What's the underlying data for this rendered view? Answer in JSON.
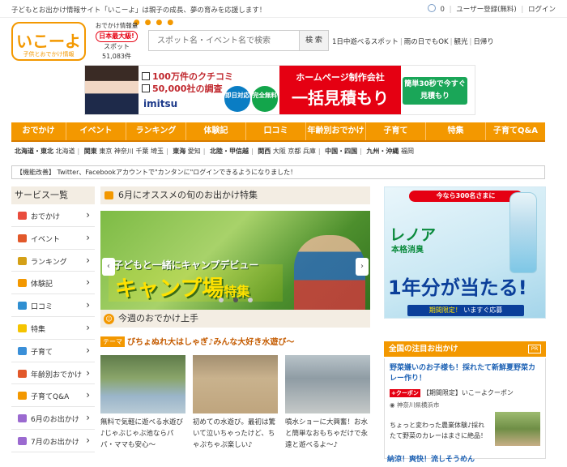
{
  "topbar": {
    "message": "子どもとお出かけ情報サイト「いこーよ」は親子の成長、夢の育みを応援します！",
    "count": "0",
    "register": "ユーザー登録(無料)",
    "login": "ログイン"
  },
  "logo": {
    "name": "いこーよ",
    "sub": "子供とおでかけ情報"
  },
  "stats": {
    "line1": "おでかけ情報量",
    "line2": "日本最大級!",
    "line3": "スポット",
    "count": "51,083件"
  },
  "search": {
    "placeholder": "スポット名・イベント名で検索",
    "button": "検 索"
  },
  "quicklinks": [
    "1日中遊べるスポット",
    "雨の日でもOK",
    "観光",
    "日帰り"
  ],
  "ad": {
    "check1": "100万件のクチコミ",
    "check2": "50,000社の調査",
    "brand": "imitsu",
    "badge1": "即日対応",
    "badge2": "完全無料",
    "headline1": "ホームページ制作会社",
    "headline2": "一括見積もり",
    "cta": "簡単30秒で今すぐ見積もり"
  },
  "nav": [
    "おでかけ",
    "イベント",
    "ランキング",
    "体験記",
    "口コミ",
    "年齢別おでかけ",
    "子育て",
    "特集",
    "子育てQ&A"
  ],
  "regions": [
    {
      "group": "北海道・東北",
      "items": [
        "北海道"
      ]
    },
    {
      "group": "関東",
      "items": [
        "東京",
        "神奈川",
        "千葉",
        "埼玉"
      ]
    },
    {
      "group": "東海",
      "items": [
        "愛知"
      ]
    },
    {
      "group": "北陸・甲信越",
      "items": []
    },
    {
      "group": "関西",
      "items": [
        "大阪",
        "京都",
        "兵庫"
      ]
    },
    {
      "group": "中国・四国",
      "items": []
    },
    {
      "group": "九州・沖縄",
      "items": [
        "福岡"
      ]
    }
  ],
  "notice": "【機能改善】 Twitter、Facebookアカウントで\"カンタンに\"ログインできるようになりました！",
  "sidebar": {
    "title": "サービス一覧",
    "items": [
      {
        "label": "おでかけ",
        "icon": "map-pin-icon",
        "color": "#e94c3d"
      },
      {
        "label": "イベント",
        "icon": "flag-icon",
        "color": "#e2582a"
      },
      {
        "label": "ランキング",
        "icon": "crown-icon",
        "color": "#d4a017"
      },
      {
        "label": "体験記",
        "icon": "notebook-icon",
        "color": "#f39800"
      },
      {
        "label": "口コミ",
        "icon": "speech-bubble-icon",
        "color": "#2f8fd1"
      },
      {
        "label": "特集",
        "icon": "folder-icon",
        "color": "#f5c400"
      },
      {
        "label": "子育て",
        "icon": "pin-icon",
        "color": "#3a8fd8"
      },
      {
        "label": "年齢別おでかけ",
        "icon": "child-icon",
        "color": "#e2582a"
      },
      {
        "label": "子育てQ&A",
        "icon": "question-icon",
        "color": "#f39800"
      },
      {
        "label": "6月のお出かけ",
        "icon": "footprint-icon",
        "color": "#9b6ad0"
      },
      {
        "label": "7月のお出かけ",
        "icon": "footprint-icon",
        "color": "#9b6ad0"
      }
    ]
  },
  "featured": {
    "title": "6月にオススメの旬のお出かけ特集",
    "hero_sub": "子どもと一緒にキャンプデビュー",
    "hero_title": "キャンプ場",
    "hero_suffix": "特集"
  },
  "weekly": {
    "title": "今週のおでかけ上手",
    "theme_tag": "テーマ",
    "theme_text": "びちょぬれ大はしゃぎ♪みんな大好き水遊び～",
    "cards": [
      {
        "caption": "無料で気軽に遊べる水遊び♪じゃぶじゃぶ池ならパパ・ママも安心～"
      },
      {
        "caption": "初めての水遊び。最初は驚いて泣いちゃったけど、ちゃぷちゃぷ楽しい♪"
      },
      {
        "caption": "噴水ショーに大興奮！お水と簡単なおもちゃだけで永遠と遊べるよ～♪"
      }
    ]
  },
  "right_ad": {
    "top": "今なら300名さまに",
    "brand": "レノア",
    "brand2": "本格消臭",
    "big": "1年分が当たる!",
    "cta_prefix": "期間限定！",
    "cta": "いますぐ応募"
  },
  "attention": {
    "title": "全国の注目お出かけ",
    "pr": "PR",
    "headline": "野菜嫌いのお子様も！採れたて新鮮夏野菜カレー作り！",
    "coupon_tag": "+クーポン",
    "coupon_text": "【期間限定】いこーよクーポン",
    "location": "神奈川県横浜市",
    "desc": "ちょっと変わった農業体験♪採れたて野菜のカレーはまさに絶品！",
    "next": "納涼！爽快！流しそうめん"
  }
}
